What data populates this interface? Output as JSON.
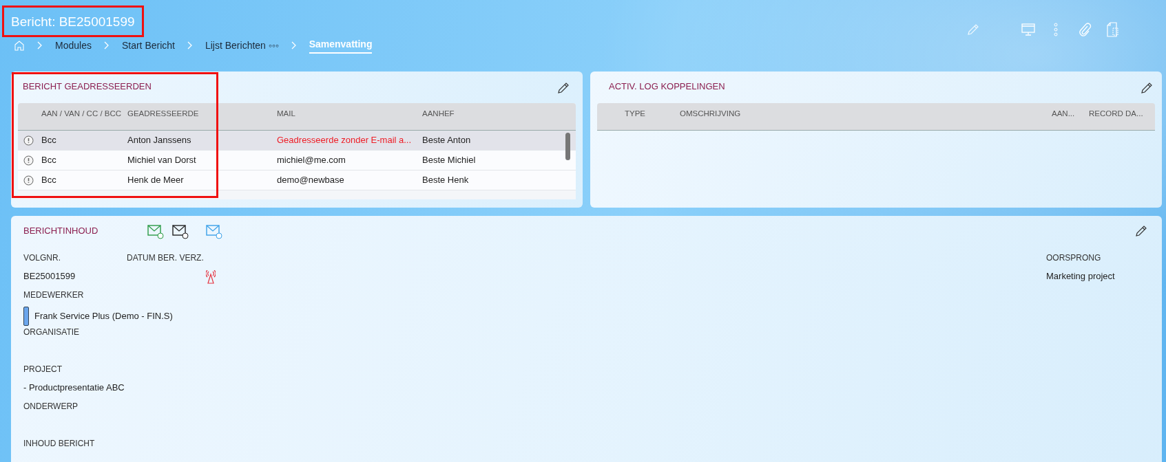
{
  "header": {
    "title": "Bericht: BE25001599"
  },
  "breadcrumb": [
    {
      "label": "Modules",
      "selected": false
    },
    {
      "label": "Start Bericht",
      "selected": false
    },
    {
      "label": "Lijst Berichten ◦◦◦",
      "selected": false
    },
    {
      "label": "Samenvatting",
      "selected": true
    }
  ],
  "recipients": {
    "title": "BERICHT GEADRESSEERDEN",
    "columns": [
      "AAN / VAN / CC / BCC",
      "GEADRESSEERDE",
      "MAIL",
      "AANHEF"
    ],
    "rows": [
      {
        "type": "Bcc",
        "name": "Anton Janssens",
        "mail": "Geadresseerde zonder E-mail a...",
        "greeting": "Beste Anton",
        "selected": true,
        "mail_error": true
      },
      {
        "type": "Bcc",
        "name": "Michiel van Dorst",
        "mail": "michiel@me.com",
        "greeting": "Beste Michiel",
        "selected": false,
        "mail_error": false
      },
      {
        "type": "Bcc",
        "name": "Henk de Meer",
        "mail": "demo@newbase",
        "greeting": "Beste Henk",
        "selected": false,
        "mail_error": false
      }
    ]
  },
  "log": {
    "title": "ACTIV. LOG KOPPELINGEN",
    "columns": [
      "TYPE",
      "OMSCHRIJVING",
      "AAN...",
      "RECORD DA..."
    ]
  },
  "content": {
    "title": "BERICHTINHOUD",
    "volgnr": {
      "label": "VOLGNR.",
      "value": "BE25001599"
    },
    "sent_date": {
      "label": "DATUM BER. VERZ."
    },
    "origin": {
      "label": "OORSPRONG",
      "value": "Marketing project"
    },
    "fields": [
      {
        "label": "MEDEWERKER",
        "value": "Frank Service Plus (Demo - FIN.S)",
        "kind": "employee"
      },
      {
        "label": "ORGANISATIE",
        "kind": "text"
      },
      {
        "label": "PROJECT",
        "value": "- Productpresentatie ABC",
        "kind": "text"
      },
      {
        "label": "ONDERWERP",
        "kind": "text"
      },
      {
        "label": "INHOUD BERICHT",
        "kind": "text"
      }
    ]
  }
}
